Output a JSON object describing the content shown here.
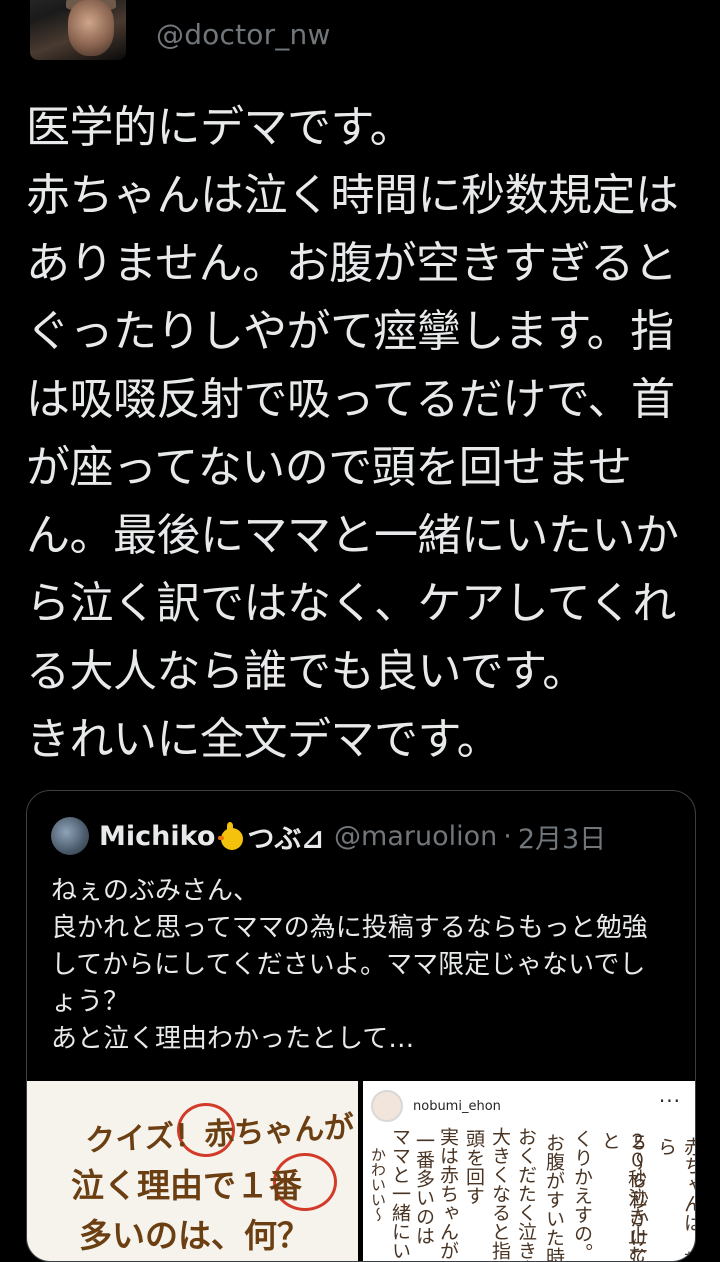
{
  "author": {
    "handle": "@doctor_nw"
  },
  "tweet": {
    "text": "医学的にデマです。\n赤ちゃんは泣く時間に秒数規定はありません。お腹が空きすぎるとぐったりしやがて痙攣します。指は吸啜反射で吸ってるだけで、首が座ってないので頭を回せません。最後にママと一緒にいたいから泣く訳ではなく、ケアしてくれる大人なら誰でも良いです。\nきれいに全文デマです。"
  },
  "quote": {
    "name": "Michiko",
    "name_suffix": "つぶ⊿",
    "handle": "@maruolion",
    "separator": "·",
    "date": "2月3日",
    "text": "ねぇのぶみさん、\n良かれと思ってママの為に投稿するならもっと勉強してからにしてくださいよ。ママ限定じゃないでしょう？\nあと泣く理由わかったとして…",
    "image_left": {
      "line1": "クイズ！赤ちゃんが",
      "line2": "泣く理由で１番",
      "line3": "多いのは、何？"
    },
    "image_right": {
      "account": "nobumi_ehon",
      "more": "···",
      "col1": "赤ちゃんは、頼ら",
      "col2": "５〜６秒かけて",
      "col3": "２０秒泣き止むと",
      "col4": "くりかえすの。",
      "col5": "お腹がすいた時",
      "col6": "おくだたく泣き声",
      "col7": "大きくなると指を",
      "col8": "頭を回す",
      "col9": "実は赤ちゃんが",
      "col10": "一番多いのは",
      "col11": "ママと一緒にいた",
      "col12": "かわいい〜"
    }
  },
  "icons": {
    "avatar": "profile-photo",
    "quote_avatar": "profile-photo",
    "chick": "chick-emoji"
  }
}
